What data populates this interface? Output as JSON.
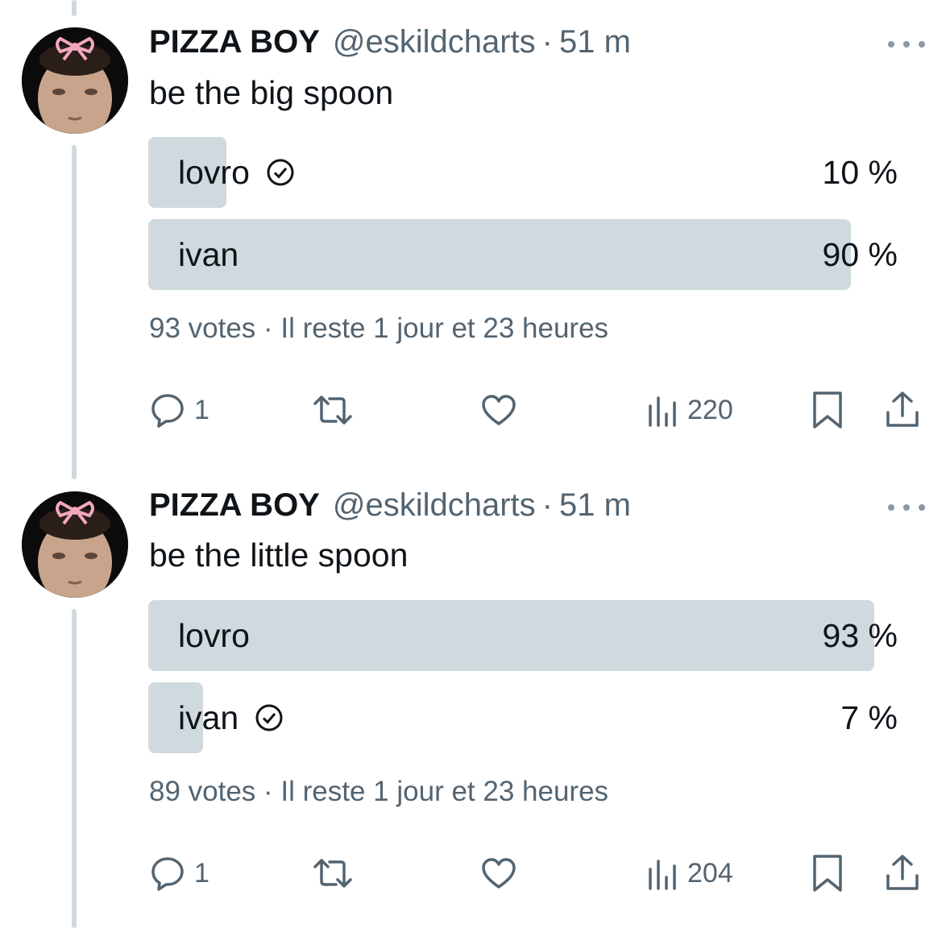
{
  "tweets": [
    {
      "name": "PIZZA BOY",
      "handle": "@eskildcharts",
      "separator": "·",
      "time": "51 m",
      "text": "be the big spoon",
      "poll": {
        "options": [
          {
            "label": "lovro",
            "percent_text": "10 %",
            "fill": 0.1,
            "selected": true
          },
          {
            "label": "ivan",
            "percent_text": "90 %",
            "fill": 0.9,
            "selected": false
          }
        ],
        "meta": "93 votes · Il reste 1 jour et 23 heures"
      },
      "replies": "1",
      "views": "220"
    },
    {
      "name": "PIZZA BOY",
      "handle": "@eskildcharts",
      "separator": "·",
      "time": "51 m",
      "text": "be the little spoon",
      "poll": {
        "options": [
          {
            "label": "lovro",
            "percent_text": "93 %",
            "fill": 0.93,
            "selected": false
          },
          {
            "label": "ivan",
            "percent_text": "7 %",
            "fill": 0.07,
            "selected": true
          }
        ],
        "meta": "89 votes · Il reste 1 jour et 23 heures"
      },
      "replies": "1",
      "views": "204"
    }
  ],
  "icons": {
    "reply": "reply-icon",
    "retweet": "retweet-icon",
    "like": "heart-icon",
    "views": "views-icon",
    "bookmark": "bookmark-icon",
    "share": "share-icon",
    "more": "more-icon",
    "verified": "check-circle-icon"
  },
  "colors": {
    "poll_fill": "#cfd9de",
    "secondary_text": "#536471",
    "thread_line": "#cfd9de",
    "bow": "#f2a7bd"
  }
}
